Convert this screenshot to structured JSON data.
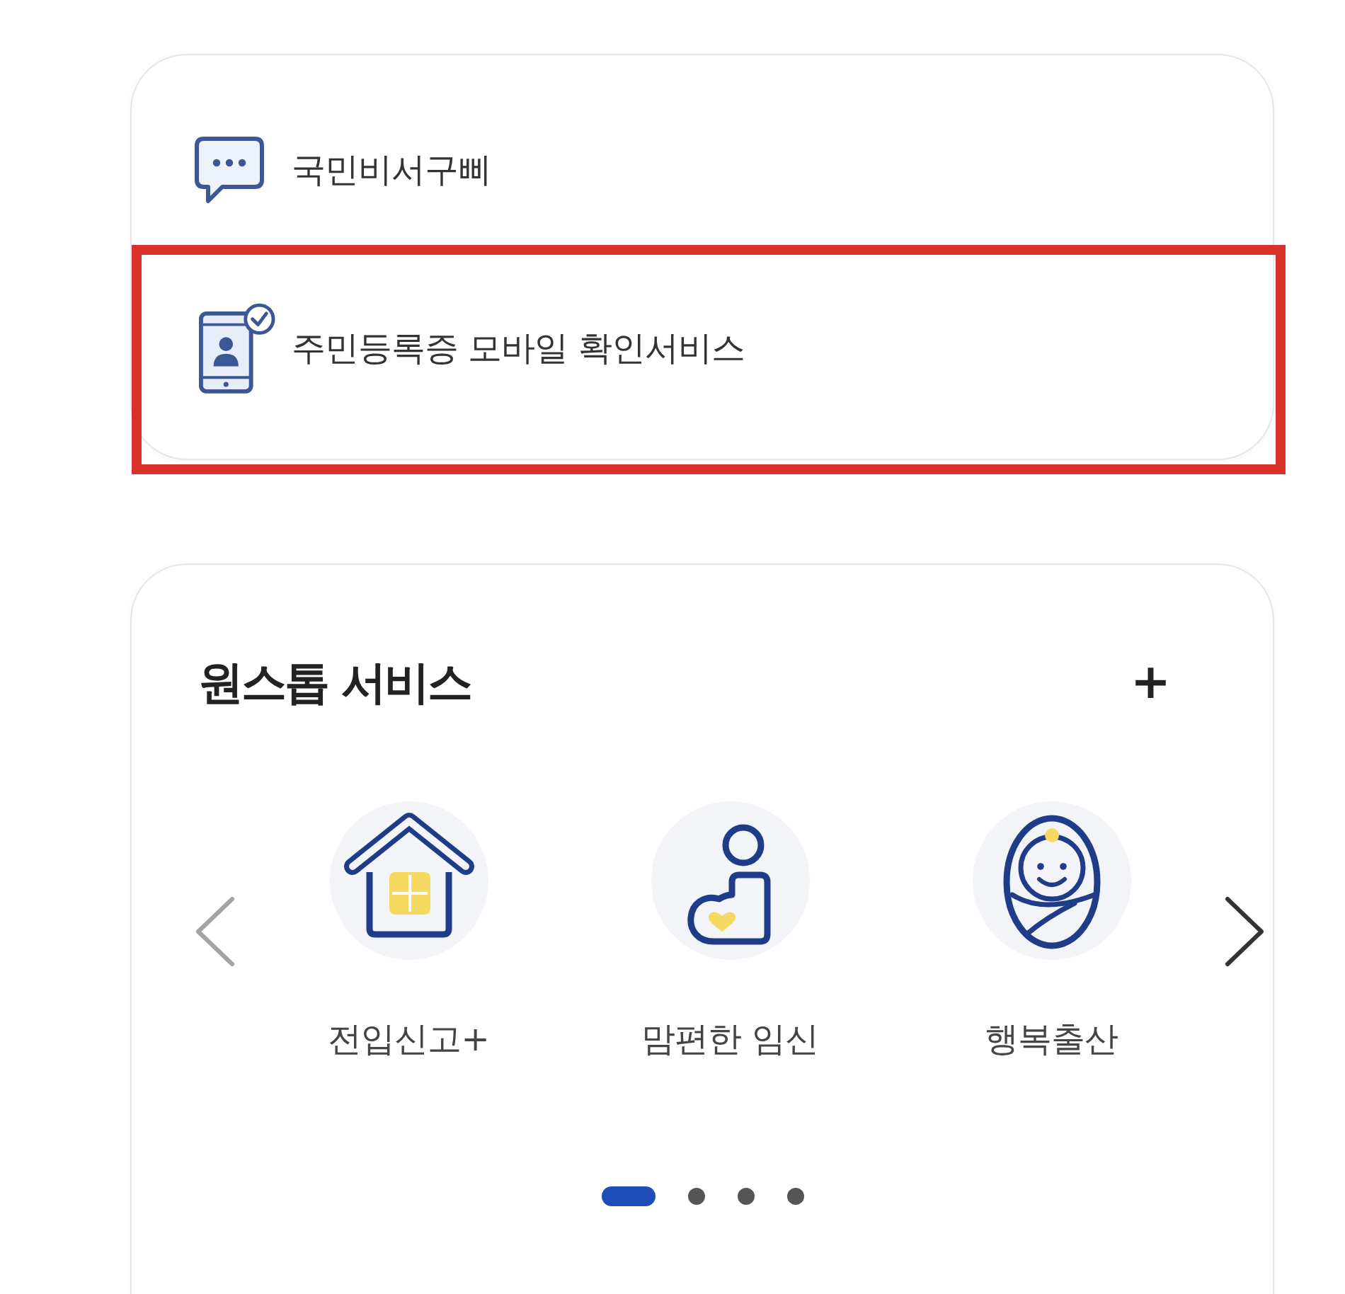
{
  "shortcuts": [
    {
      "kind": "chat",
      "label": "국민비서구삐",
      "highlighted": false
    },
    {
      "kind": "id-phone",
      "label": "주민등록증 모바일 확인서비스",
      "highlighted": true
    }
  ],
  "one_stop": {
    "title": "원스톱 서비스",
    "more_button": "+",
    "prev_arrow": {
      "disabled": true
    },
    "next_arrow": {
      "disabled": false
    },
    "services": [
      {
        "kind": "house",
        "label": "전입신고+"
      },
      {
        "kind": "pregnancy",
        "label": "맘편한 임신"
      },
      {
        "kind": "baby",
        "label": "행복출산"
      }
    ],
    "pages": [
      {
        "selected": true
      },
      {
        "selected": false
      },
      {
        "selected": false
      },
      {
        "selected": false
      }
    ]
  }
}
